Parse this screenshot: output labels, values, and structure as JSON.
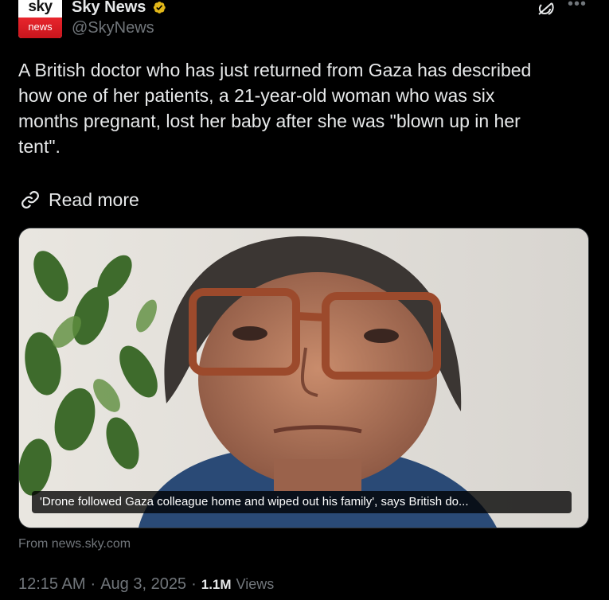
{
  "author": {
    "avatar_top": "sky",
    "avatar_bottom": "news",
    "display_name": "Sky News",
    "handle": "@SkyNews",
    "verified_color": "#e2b719",
    "brand_red": "#e8252d"
  },
  "tweet": {
    "text": "A British doctor who has just returned from Gaza has described\nhow one of her patients, a 21-year-old woman who was six\nmonths pregnant, lost her baby after she was \"blown up in her\ntent\".",
    "read_more": "Read more",
    "source": "From news.sky.com"
  },
  "media": {
    "caption": "'Drone followed Gaza colleague home and wiped out his family', says British do..."
  },
  "meta": {
    "time": "12:15 AM",
    "date": "Aug 3, 2025",
    "views_count": "1.1M",
    "views_label": "Views",
    "separator": "·"
  },
  "icons": {
    "verified": "verified-badge-icon",
    "grok": "grok-icon",
    "more": "more-options-icon",
    "link": "link-icon"
  }
}
